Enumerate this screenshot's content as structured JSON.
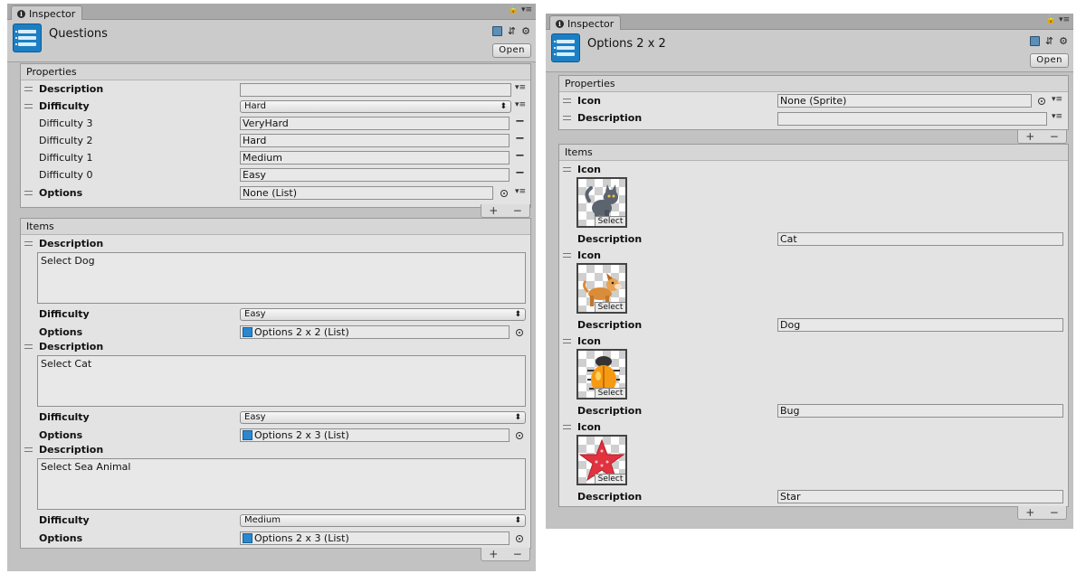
{
  "left": {
    "tab_label": "Inspector",
    "asset_title": "Questions",
    "open_label": "Open",
    "properties_header": "Properties",
    "props": {
      "description_label": "Description",
      "difficulty_label": "Difficulty",
      "difficulty_value": "Hard",
      "levels": [
        {
          "label": "Difficulty 3",
          "value": "VeryHard"
        },
        {
          "label": "Difficulty 2",
          "value": "Hard"
        },
        {
          "label": "Difficulty 1",
          "value": "Medium"
        },
        {
          "label": "Difficulty 0",
          "value": "Easy"
        }
      ],
      "options_label": "Options",
      "options_value": "None (List)"
    },
    "items_header": "Items",
    "items": [
      {
        "description_label": "Description",
        "description": "Select Dog",
        "difficulty_label": "Difficulty",
        "difficulty": "Easy",
        "options_label": "Options",
        "options": "Options 2 x 2 (List)"
      },
      {
        "description_label": "Description",
        "description": "Select Cat",
        "difficulty_label": "Difficulty",
        "difficulty": "Easy",
        "options_label": "Options",
        "options": "Options 2 x 3 (List)"
      },
      {
        "description_label": "Description",
        "description": "Select Sea Animal",
        "difficulty_label": "Difficulty",
        "difficulty": "Medium",
        "options_label": "Options",
        "options": "Options 2 x 3 (List)"
      }
    ]
  },
  "right": {
    "tab_label": "Inspector",
    "asset_title": "Options 2 x 2",
    "open_label": "Open",
    "properties_header": "Properties",
    "props": {
      "icon_label": "Icon",
      "icon_value": "None (Sprite)",
      "description_label": "Description"
    },
    "items_header": "Items",
    "select_label": "Select",
    "items": [
      {
        "icon_label": "Icon",
        "icon": "cat-icon",
        "description_label": "Description",
        "description": "Cat"
      },
      {
        "icon_label": "Icon",
        "icon": "dog-icon",
        "description_label": "Description",
        "description": "Dog"
      },
      {
        "icon_label": "Icon",
        "icon": "bug-icon",
        "description_label": "Description",
        "description": "Bug"
      },
      {
        "icon_label": "Icon",
        "icon": "star-icon",
        "description_label": "Description",
        "description": "Star"
      }
    ]
  }
}
